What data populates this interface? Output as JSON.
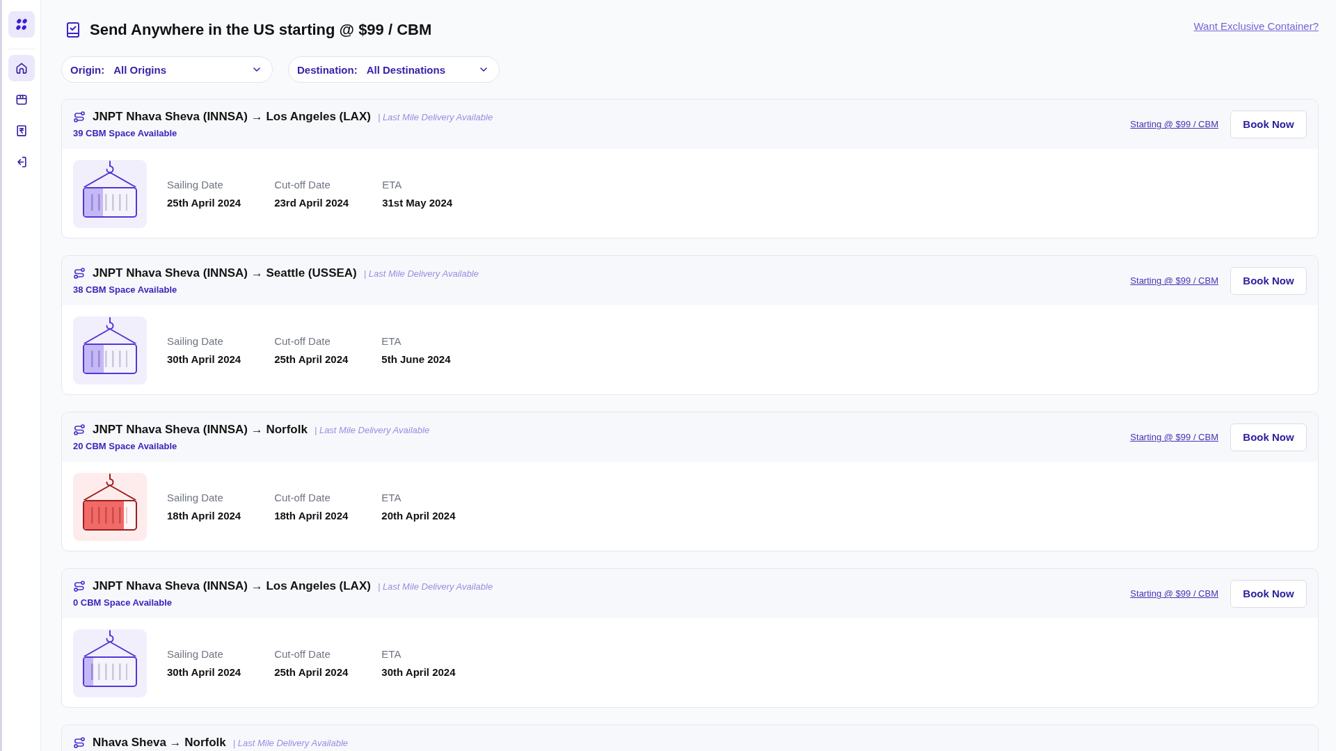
{
  "sidebar": {
    "items": [
      {
        "selected": true
      },
      {
        "selected": false
      },
      {
        "selected": false
      },
      {
        "selected": false
      }
    ]
  },
  "header": {
    "title": "Send Anywhere in the US starting @ $99 / CBM",
    "link": "Want Exclusive Container?"
  },
  "filters": [
    {
      "label": "Origin:",
      "value": "All Origins"
    },
    {
      "label": "Destination:",
      "value": "All Destinations"
    }
  ],
  "routes": [
    {
      "route": "JNPT Nhava Sheva (INNSA) → Los Angeles (LAX)",
      "note": "| Last Mile Delivery Available",
      "space": "39 CBM Space Available",
      "price_link": "Starting @ $99 / CBM",
      "button": "Book Now",
      "level": 0.37,
      "almost_full": false,
      "dates": [
        {
          "label": "Sailing Date",
          "value": "25th April 2024"
        },
        {
          "label": "Cut-off Date",
          "value": "23rd April 2024"
        },
        {
          "label": "ETA",
          "value": "31st May 2024"
        }
      ]
    },
    {
      "route": "JNPT Nhava Sheva (INNSA) → Seattle (USSEA)",
      "note": "| Last Mile Delivery Available",
      "space": "38 CBM Space Available",
      "price_link": "Starting @ $99 / CBM",
      "button": "Book Now",
      "level": 0.38,
      "almost_full": false,
      "dates": [
        {
          "label": "Sailing Date",
          "value": "30th April 2024"
        },
        {
          "label": "Cut-off Date",
          "value": "25th April 2024"
        },
        {
          "label": "ETA",
          "value": "5th June 2024"
        }
      ]
    },
    {
      "route": "JNPT Nhava Sheva (INNSA) → Norfolk",
      "note": "| Last Mile Delivery Available",
      "space": "20 CBM Space Available",
      "price_link": "Starting @ $99 / CBM",
      "button": "Book Now",
      "level": 0.77,
      "almost_full": true,
      "dates": [
        {
          "label": "Sailing Date",
          "value": "18th April 2024"
        },
        {
          "label": "Cut-off Date",
          "value": "18th April 2024"
        },
        {
          "label": "ETA",
          "value": "20th April 2024"
        }
      ]
    },
    {
      "route": "JNPT Nhava Sheva (INNSA) → Los Angeles (LAX)",
      "note": "| Last Mile Delivery Available",
      "space": "0 CBM Space Available",
      "price_link": "Starting @ $99 / CBM",
      "button": "Book Now",
      "level": 0.18,
      "almost_full": false,
      "dates": [
        {
          "label": "Sailing Date",
          "value": "30th April 2024"
        },
        {
          "label": "Cut-off Date",
          "value": "25th April 2024"
        },
        {
          "label": "ETA",
          "value": "30th April 2024"
        }
      ]
    },
    {
      "route": "Nhava Sheva → Norfolk",
      "note": "| Last Mile Delivery Available"
    }
  ]
}
